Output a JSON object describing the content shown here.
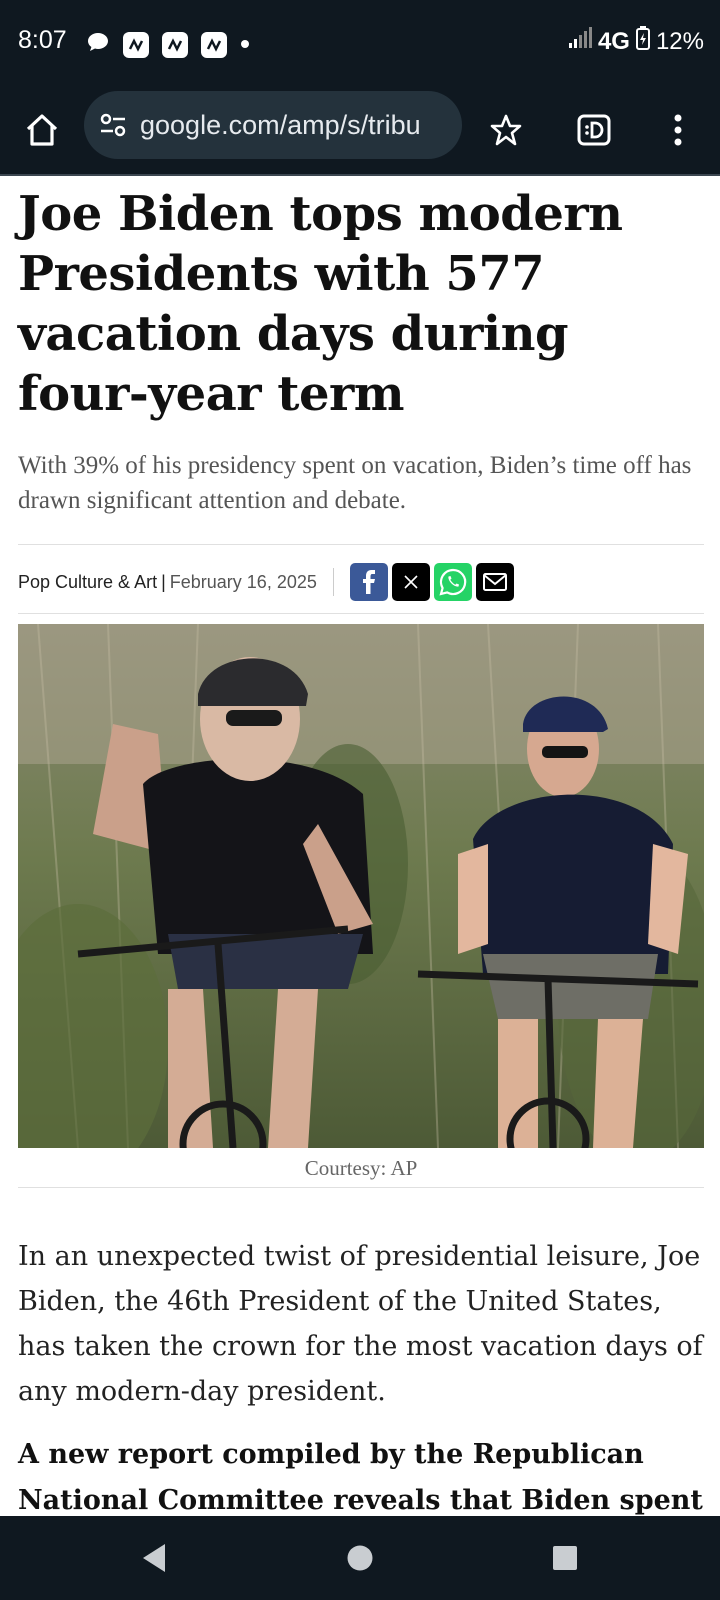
{
  "status": {
    "time": "8:07",
    "network": "4G",
    "battery": "12%",
    "notification_icons": [
      "chat-bubble-icon",
      "app-notification-icon",
      "app-notification-icon",
      "app-notification-icon",
      "more-dot-icon"
    ]
  },
  "browser": {
    "url": "google.com/amp/s/tribu",
    "icons": [
      "home-icon",
      "site-settings-icon",
      "bookmark-star-icon",
      "tab-switcher-icon",
      "overflow-menu-icon"
    ]
  },
  "article": {
    "headline": "Joe Biden tops modern Presidents with 577 vacation days during four-year term",
    "subheadline": "With 39% of his presidency spent on vacation, Biden’s time off has drawn significant attention and debate.",
    "category": "Pop Culture & Art",
    "separator": "|",
    "date": "February 16, 2025",
    "share": [
      {
        "name": "facebook",
        "color": "#3b5998"
      },
      {
        "name": "x",
        "color": "#000000"
      },
      {
        "name": "whatsapp",
        "color": "#25d366"
      },
      {
        "name": "email",
        "color": "#000000"
      }
    ],
    "image_caption": "Courtesy: AP",
    "paragraph1": "In an unexpected twist of presidential leisure, Joe Biden, the 46th President of the United States, has taken the crown for the most vacation days of any modern-day president.",
    "paragraph2": "A new report compiled by the Republican National Committee reveals that Biden spent a"
  },
  "navigation": {
    "icons": [
      "back-icon",
      "home-circle-icon",
      "recents-icon"
    ]
  }
}
